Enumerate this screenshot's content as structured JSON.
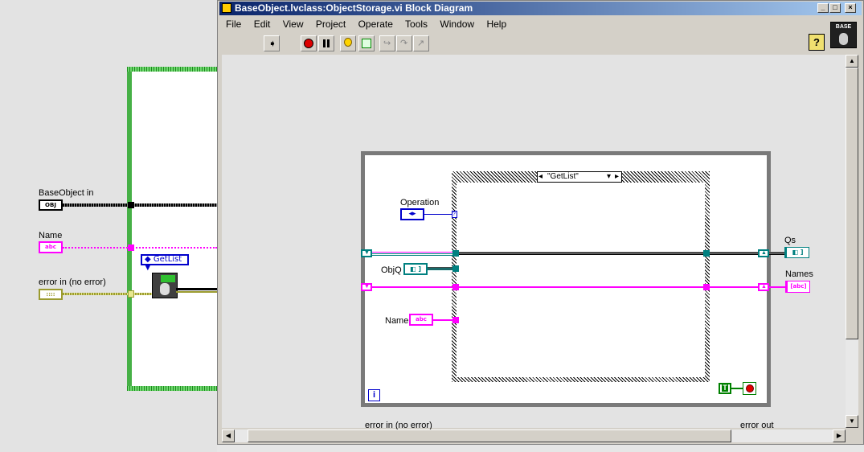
{
  "back_diagram": {
    "labels": {
      "base_object_in": "BaseObject in",
      "name": "Name",
      "error_in": "error in (no error)"
    },
    "terminals": {
      "obj": "OBJ",
      "abc": "abc",
      "err": "::::"
    },
    "case_selector": "GetList"
  },
  "window": {
    "title": "BaseObject.lvclass:ObjectStorage.vi Block Diagram",
    "menu": [
      "File",
      "Edit",
      "View",
      "Project",
      "Operate",
      "Tools",
      "Window",
      "Help"
    ],
    "base_icon_label": "BASE",
    "help_label": "?"
  },
  "diagram": {
    "case_selector": "\"GetList\"",
    "controls": {
      "operation": "Operation",
      "objq": "ObjQ",
      "name": "Name",
      "qs": "Qs",
      "names": "Names"
    },
    "loop_iteration": "i",
    "stop_terminal": "T",
    "bottom_labels": {
      "error_in": "error in (no error)",
      "error_out": "error out"
    }
  },
  "colors": {
    "pink_wire": "#ff00ff",
    "teal_wire": "#008080",
    "error_wire": "#9b9b2f",
    "loop_green": "#38b838",
    "enum_blue": "#0000cc"
  }
}
